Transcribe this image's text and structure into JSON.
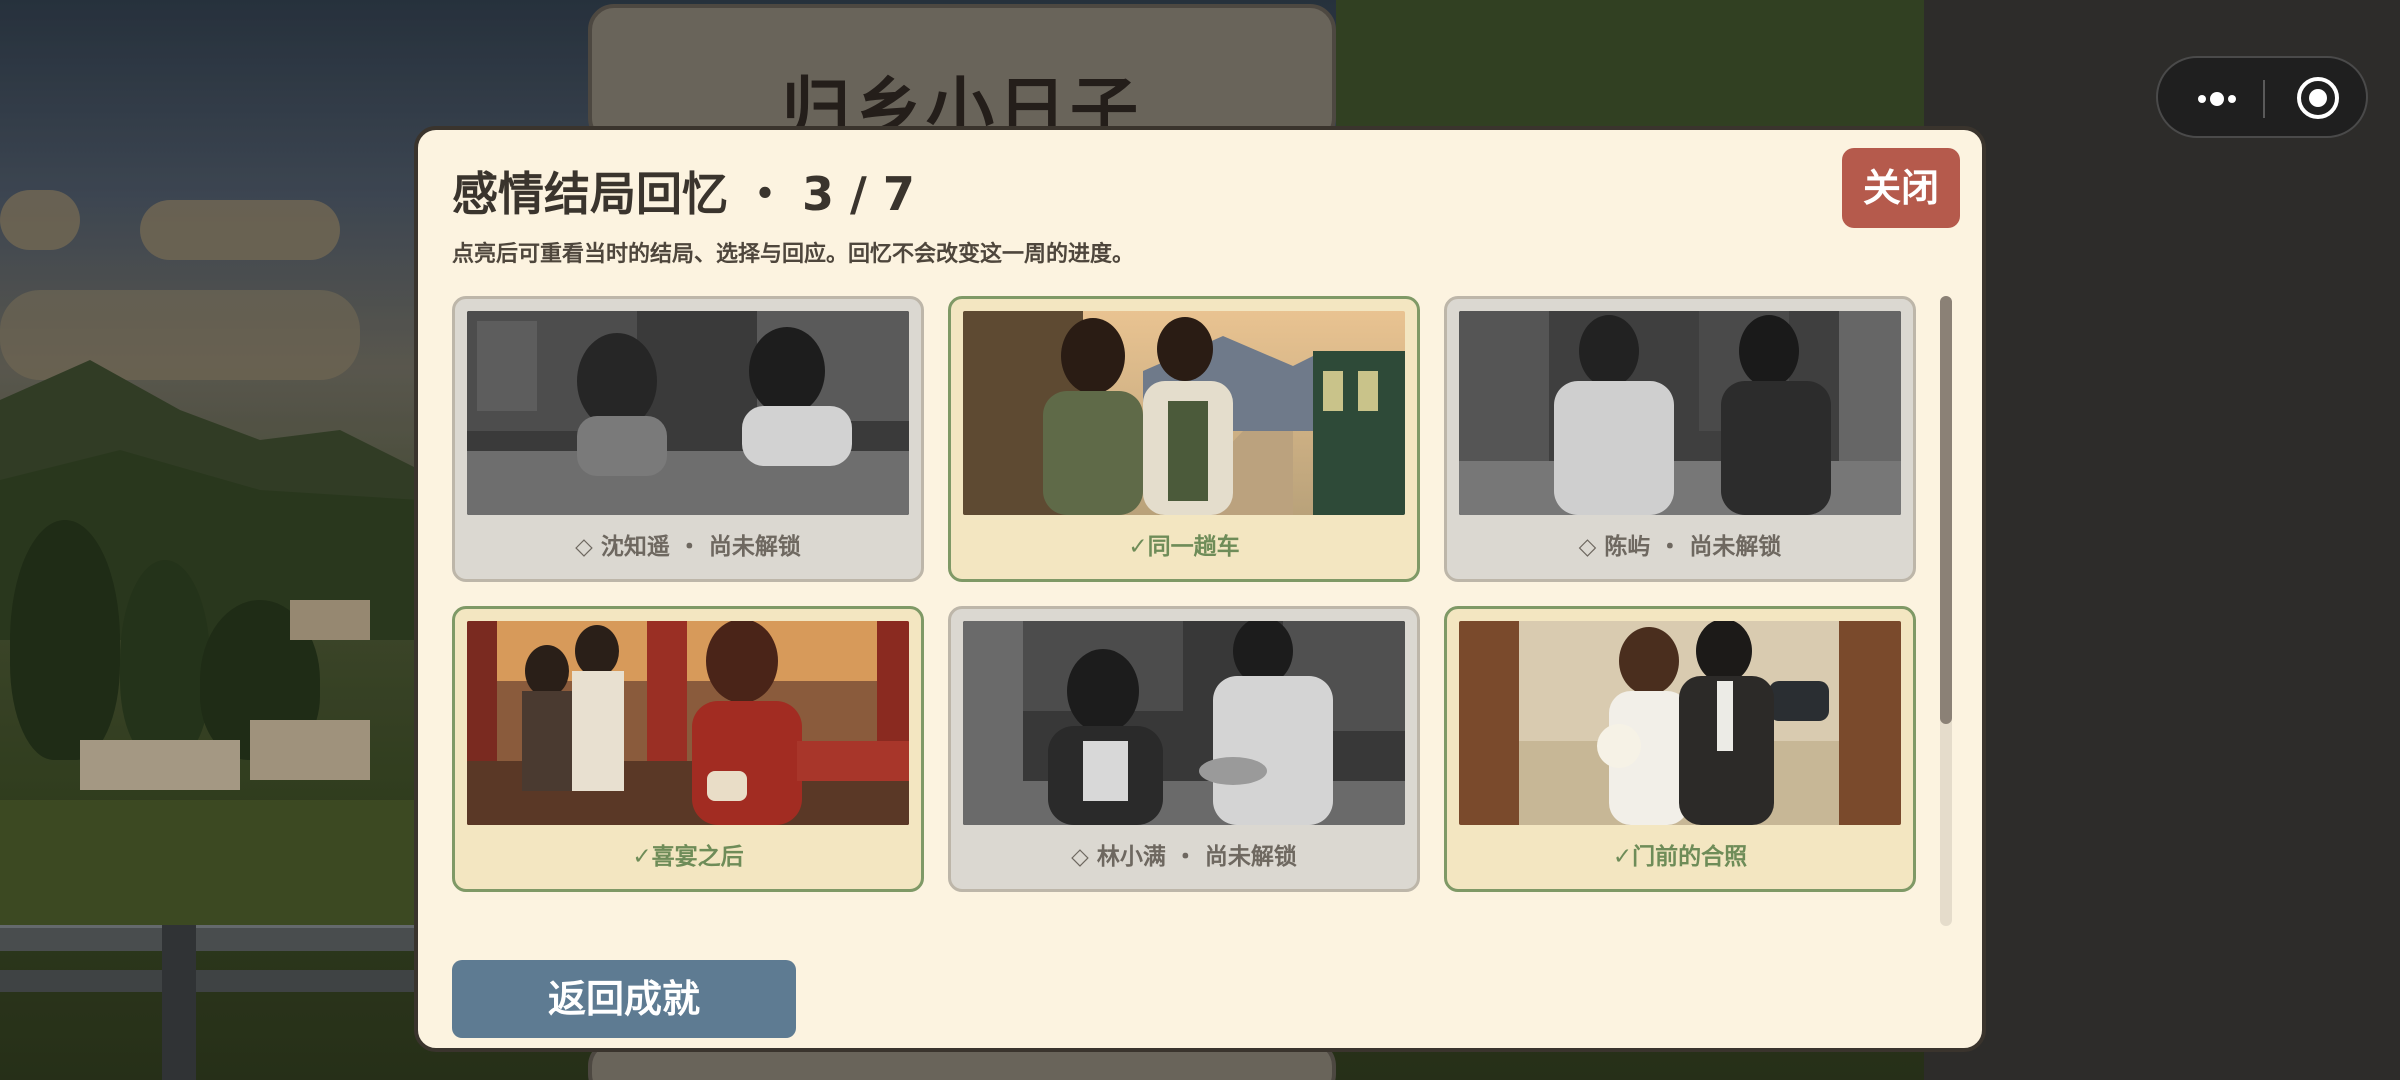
{
  "game": {
    "title": "归乡小日子"
  },
  "modal": {
    "title": "感情结局回忆",
    "progress": "3 / 7",
    "progress_separator": "・",
    "description": "点亮后可重看当时的结局、选择与回应。回忆不会改变这一周的进度。",
    "close_label": "关闭",
    "back_label": "返回成就"
  },
  "memories": [
    {
      "label": "◇ 沈知遥 ・ 尚未解锁",
      "unlocked": false,
      "scene": "desk-two"
    },
    {
      "label": "✓同一趟车",
      "unlocked": true,
      "scene": "train-station"
    },
    {
      "label": "◇ 陈屿 ・ 尚未解锁",
      "unlocked": false,
      "scene": "kitchen-two"
    },
    {
      "label": "✓喜宴之后",
      "unlocked": true,
      "scene": "wedding-banquet"
    },
    {
      "label": "◇ 林小满 ・ 尚未解锁",
      "unlocked": false,
      "scene": "dinner-two"
    },
    {
      "label": "✓门前的合照",
      "unlocked": true,
      "scene": "doorway-photo"
    }
  ],
  "scroll": {
    "position_fraction": 0.0,
    "visible_fraction": 0.68
  },
  "colors": {
    "unlocked_text": "#6e8c58",
    "locked_text": "#6e6860",
    "close_button": "#b55a4c",
    "back_button": "#5e7b92",
    "modal_bg": "#fcf3e0"
  },
  "icons": {
    "menu": "more-dots-icon",
    "exit": "target-circle-icon"
  }
}
